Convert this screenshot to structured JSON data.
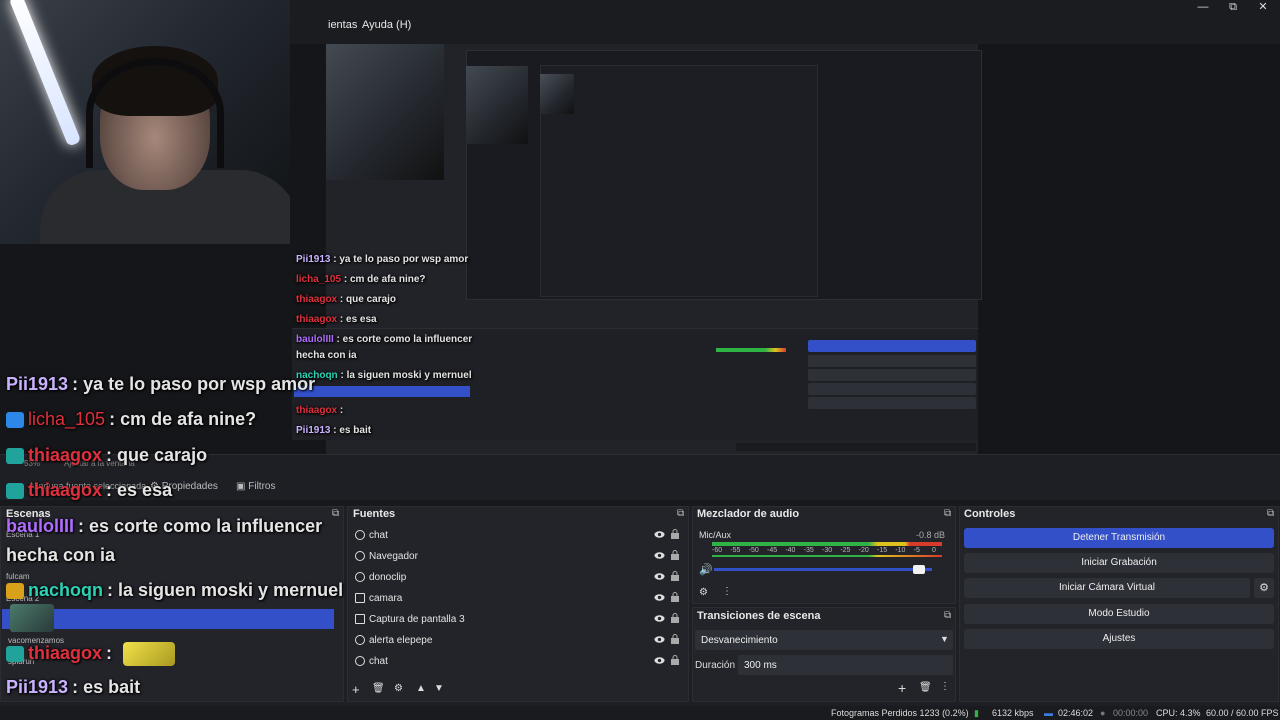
{
  "menu": {
    "tools_fragment": "ientas",
    "help": "Ayuda (H)"
  },
  "window_controls": {
    "minimize": "—",
    "maximize": "⧉",
    "close": "✕"
  },
  "chat": [
    {
      "user": "Pii1913",
      "user_color": "#c9b2ff",
      "sep": ":",
      "message": "ya te lo paso por wsp amor",
      "badge": null
    },
    {
      "user": "licha_105",
      "user_color": "#e0303d",
      "sep": ":",
      "message": "cm de afa nine?",
      "badge": "#2c87e8"
    },
    {
      "user": "thiaagox",
      "user_color": "#e0303d",
      "sep": ":",
      "message": "que carajo",
      "badge": "#1fa39a"
    },
    {
      "user": "thiaagox",
      "user_color": "#e0303d",
      "sep": ":",
      "message": "es esa",
      "badge": "#1fa39a"
    },
    {
      "user": "baulolIII",
      "user_color": "#b06cff",
      "sep": ":",
      "message": "es corte como la influencer",
      "badge": null
    },
    {
      "user": "",
      "user_color": "#ffffff",
      "sep": "",
      "message": "hecha con ia",
      "badge": null
    },
    {
      "user": "nachoqn",
      "user_color": "#2bd3b6",
      "sep": ":",
      "message": "la siguen moski y mernuel",
      "badge": "#d9a01a"
    },
    {
      "user": "thiaagox",
      "user_color": "#e0303d",
      "sep": ":",
      "message": "",
      "badge": "#1fa39a"
    },
    {
      "user": "Pii1913",
      "user_color": "#c9b2ff",
      "sep": ":",
      "message": "es bait",
      "badge": null
    }
  ],
  "properties_bar": {
    "zoom": "53%",
    "fit": "Ajustar a la ventana",
    "no_source": "Ninguna fuente seleccionada",
    "properties": "Propiedades",
    "filters": "Filtros"
  },
  "scenes": {
    "title": "Escenas",
    "items": [
      "Escena 1",
      "fulcam",
      "Escena 2",
      "vacomenzamos",
      "spidrun"
    ]
  },
  "sources": {
    "title": "Fuentes",
    "items": [
      {
        "label": "chat",
        "icon": "globe-icon"
      },
      {
        "label": "Navegador",
        "icon": "globe-icon"
      },
      {
        "label": "donoclip",
        "icon": "globe-icon"
      },
      {
        "label": "camara",
        "icon": "camera-icon"
      },
      {
        "label": "Captura de pantalla 3",
        "icon": "monitor-icon"
      },
      {
        "label": "alerta elepepe",
        "icon": "globe-icon"
      },
      {
        "label": "chat",
        "icon": "globe-icon"
      }
    ]
  },
  "mixer": {
    "title": "Mezclador de audio",
    "channel": "Mic/Aux",
    "level": "-0.8 dB",
    "scale": [
      "-60",
      "-55",
      "-50",
      "-45",
      "-40",
      "-35",
      "-30",
      "-25",
      "-20",
      "-15",
      "-10",
      "-5",
      "0"
    ],
    "volume": 0.97
  },
  "transitions": {
    "title": "Transiciones de escena",
    "selected": "Desvanecimiento",
    "duration_label": "Duración",
    "duration_value": "300 ms"
  },
  "controls": {
    "title": "Controles",
    "stop_stream": "Detener Transmisión",
    "start_recording": "Iniciar Grabación",
    "virtual_camera": "Iniciar Cámara Virtual",
    "studio_mode": "Modo Estudio",
    "settings": "Ajustes"
  },
  "status": {
    "dropped": "Fotogramas Perdidos 1233 (0.2%)",
    "bitrate": "6132 kbps",
    "stream_time": "02:46:02",
    "rec_time": "00:00:00",
    "cpu": "CPU: 4.3%",
    "fps": "60.00 / 60.00 FPS"
  },
  "colors": {
    "accent": "#3350c9",
    "meter_green": "#2fb344",
    "meter_yellow": "#e0c21e",
    "meter_red": "#d83b2a"
  }
}
